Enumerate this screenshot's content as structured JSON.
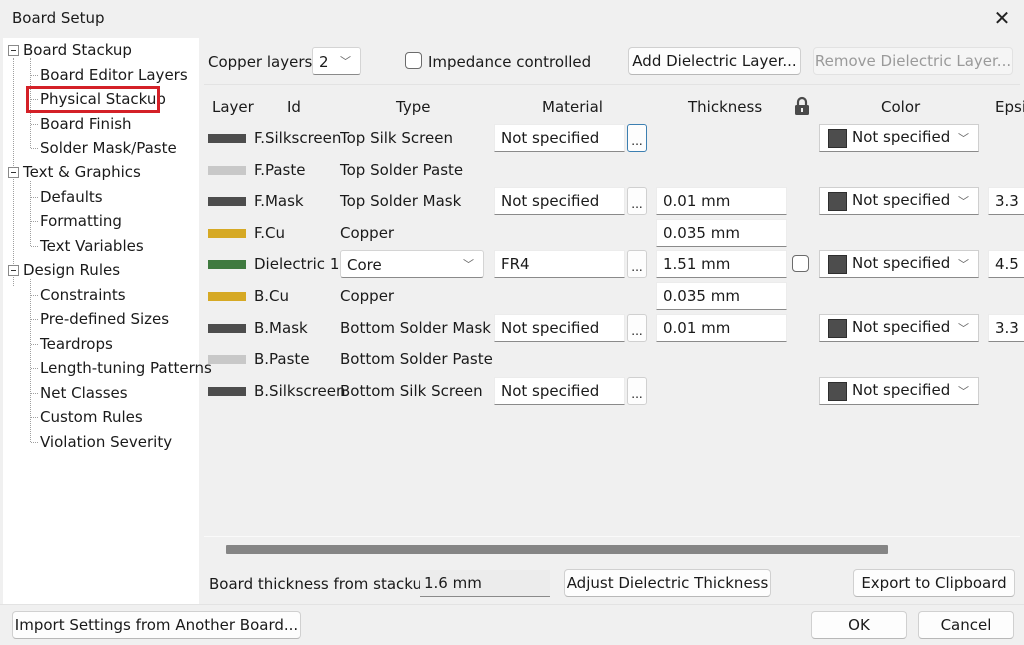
{
  "window": {
    "title": "Board Setup",
    "close_icon": "close-icon"
  },
  "tree": {
    "groups": [
      {
        "label": "Board Stackup",
        "children": [
          "Board Editor Layers",
          "Physical Stackup",
          "Board Finish",
          "Solder Mask/Paste"
        ]
      },
      {
        "label": "Text & Graphics",
        "children": [
          "Defaults",
          "Formatting",
          "Text Variables"
        ]
      },
      {
        "label": "Design Rules",
        "children": [
          "Constraints",
          "Pre-defined Sizes",
          "Teardrops",
          "Length-tuning Patterns",
          "Net Classes",
          "Custom Rules",
          "Violation Severity"
        ]
      }
    ],
    "selected": "Physical Stackup"
  },
  "toolbar": {
    "copper_layers_label": "Copper layers:",
    "copper_layers_value": "2",
    "impedance_label": "Impedance controlled",
    "impedance_checked": false,
    "add_dielectric_label": "Add Dielectric Layer...",
    "remove_dielectric_label": "Remove Dielectric Layer..."
  },
  "table": {
    "headers": {
      "layer": "Layer",
      "id": "Id",
      "type": "Type",
      "material": "Material",
      "thickness": "Thickness",
      "lock": "lock-icon",
      "color": "Color",
      "epsilon": "Epsi"
    },
    "rows": [
      {
        "swatch": "#4d4d4d",
        "id": "F.Silkscreen",
        "type": "Top Silk Screen",
        "material": "Not specified",
        "thickness": null,
        "color": "Not specified",
        "epsilon": null
      },
      {
        "swatch": "#c8c8c8",
        "id": "F.Paste",
        "type": "Top Solder Paste",
        "material": null,
        "thickness": null,
        "color": null,
        "epsilon": null
      },
      {
        "swatch": "#4d4d4d",
        "id": "F.Mask",
        "type": "Top Solder Mask",
        "material": "Not specified",
        "thickness": "0.01 mm",
        "color": "Not specified",
        "epsilon": "3.3"
      },
      {
        "swatch": "#d6a924",
        "id": "F.Cu",
        "type": "Copper",
        "material": null,
        "thickness": "0.035 mm",
        "color": null,
        "epsilon": null
      },
      {
        "swatch": "#3f7a3f",
        "id": "Dielectric 1",
        "type": "Core",
        "material": "FR4",
        "thickness": "1.51 mm",
        "color": "Not specified",
        "epsilon": "4.5"
      },
      {
        "swatch": "#d6a924",
        "id": "B.Cu",
        "type": "Copper",
        "material": null,
        "thickness": "0.035 mm",
        "color": null,
        "epsilon": null
      },
      {
        "swatch": "#4d4d4d",
        "id": "B.Mask",
        "type": "Bottom Solder Mask",
        "material": "Not specified",
        "thickness": "0.01 mm",
        "color": "Not specified",
        "epsilon": "3.3"
      },
      {
        "swatch": "#c8c8c8",
        "id": "B.Paste",
        "type": "Bottom Solder Paste",
        "material": null,
        "thickness": null,
        "color": null,
        "epsilon": null
      },
      {
        "swatch": "#4d4d4d",
        "id": "B.Silkscreen",
        "type": "Bottom Silk Screen",
        "material": "Not specified",
        "thickness": null,
        "color": "Not specified",
        "epsilon": null
      }
    ]
  },
  "footer": {
    "board_thickness_label": "Board thickness from stackup:",
    "board_thickness_value": "1.6 mm",
    "adjust_label": "Adjust Dielectric Thickness",
    "export_label": "Export to Clipboard",
    "import_label": "Import Settings from Another Board...",
    "ok_label": "OK",
    "cancel_label": "Cancel"
  },
  "colors": {
    "selection_highlight": "#d42027",
    "copper": "#d6a924",
    "dielectric": "#3f7a3f",
    "mask": "#4d4d4d",
    "paste": "#c8c8c8"
  }
}
